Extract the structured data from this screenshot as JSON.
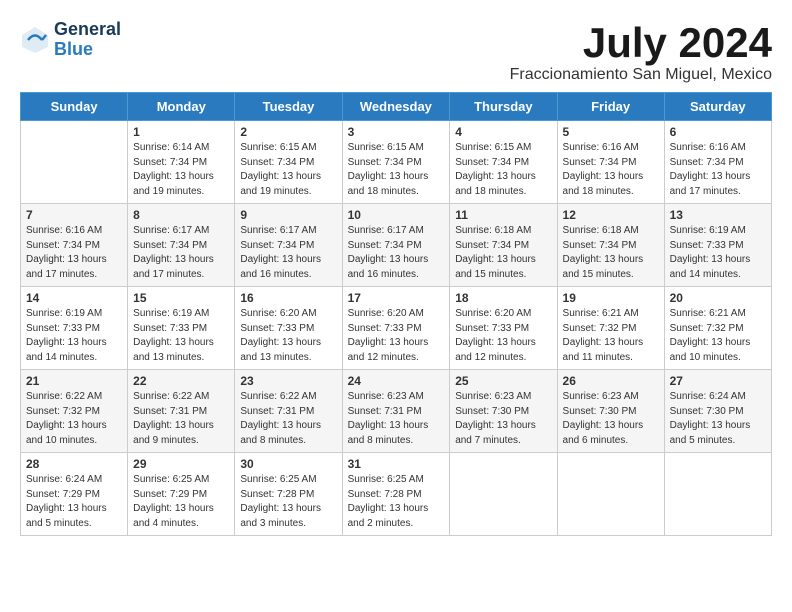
{
  "header": {
    "logo_general": "General",
    "logo_blue": "Blue",
    "month_title": "July 2024",
    "location": "Fraccionamiento San Miguel, Mexico"
  },
  "weekdays": [
    "Sunday",
    "Monday",
    "Tuesday",
    "Wednesday",
    "Thursday",
    "Friday",
    "Saturday"
  ],
  "weeks": [
    [
      {
        "day": "",
        "sunrise": "",
        "sunset": "",
        "daylight": ""
      },
      {
        "day": "1",
        "sunrise": "Sunrise: 6:14 AM",
        "sunset": "Sunset: 7:34 PM",
        "daylight": "Daylight: 13 hours and 19 minutes."
      },
      {
        "day": "2",
        "sunrise": "Sunrise: 6:15 AM",
        "sunset": "Sunset: 7:34 PM",
        "daylight": "Daylight: 13 hours and 19 minutes."
      },
      {
        "day": "3",
        "sunrise": "Sunrise: 6:15 AM",
        "sunset": "Sunset: 7:34 PM",
        "daylight": "Daylight: 13 hours and 18 minutes."
      },
      {
        "day": "4",
        "sunrise": "Sunrise: 6:15 AM",
        "sunset": "Sunset: 7:34 PM",
        "daylight": "Daylight: 13 hours and 18 minutes."
      },
      {
        "day": "5",
        "sunrise": "Sunrise: 6:16 AM",
        "sunset": "Sunset: 7:34 PM",
        "daylight": "Daylight: 13 hours and 18 minutes."
      },
      {
        "day": "6",
        "sunrise": "Sunrise: 6:16 AM",
        "sunset": "Sunset: 7:34 PM",
        "daylight": "Daylight: 13 hours and 17 minutes."
      }
    ],
    [
      {
        "day": "7",
        "sunrise": "Sunrise: 6:16 AM",
        "sunset": "Sunset: 7:34 PM",
        "daylight": "Daylight: 13 hours and 17 minutes."
      },
      {
        "day": "8",
        "sunrise": "Sunrise: 6:17 AM",
        "sunset": "Sunset: 7:34 PM",
        "daylight": "Daylight: 13 hours and 17 minutes."
      },
      {
        "day": "9",
        "sunrise": "Sunrise: 6:17 AM",
        "sunset": "Sunset: 7:34 PM",
        "daylight": "Daylight: 13 hours and 16 minutes."
      },
      {
        "day": "10",
        "sunrise": "Sunrise: 6:17 AM",
        "sunset": "Sunset: 7:34 PM",
        "daylight": "Daylight: 13 hours and 16 minutes."
      },
      {
        "day": "11",
        "sunrise": "Sunrise: 6:18 AM",
        "sunset": "Sunset: 7:34 PM",
        "daylight": "Daylight: 13 hours and 15 minutes."
      },
      {
        "day": "12",
        "sunrise": "Sunrise: 6:18 AM",
        "sunset": "Sunset: 7:34 PM",
        "daylight": "Daylight: 13 hours and 15 minutes."
      },
      {
        "day": "13",
        "sunrise": "Sunrise: 6:19 AM",
        "sunset": "Sunset: 7:33 PM",
        "daylight": "Daylight: 13 hours and 14 minutes."
      }
    ],
    [
      {
        "day": "14",
        "sunrise": "Sunrise: 6:19 AM",
        "sunset": "Sunset: 7:33 PM",
        "daylight": "Daylight: 13 hours and 14 minutes."
      },
      {
        "day": "15",
        "sunrise": "Sunrise: 6:19 AM",
        "sunset": "Sunset: 7:33 PM",
        "daylight": "Daylight: 13 hours and 13 minutes."
      },
      {
        "day": "16",
        "sunrise": "Sunrise: 6:20 AM",
        "sunset": "Sunset: 7:33 PM",
        "daylight": "Daylight: 13 hours and 13 minutes."
      },
      {
        "day": "17",
        "sunrise": "Sunrise: 6:20 AM",
        "sunset": "Sunset: 7:33 PM",
        "daylight": "Daylight: 13 hours and 12 minutes."
      },
      {
        "day": "18",
        "sunrise": "Sunrise: 6:20 AM",
        "sunset": "Sunset: 7:33 PM",
        "daylight": "Daylight: 13 hours and 12 minutes."
      },
      {
        "day": "19",
        "sunrise": "Sunrise: 6:21 AM",
        "sunset": "Sunset: 7:32 PM",
        "daylight": "Daylight: 13 hours and 11 minutes."
      },
      {
        "day": "20",
        "sunrise": "Sunrise: 6:21 AM",
        "sunset": "Sunset: 7:32 PM",
        "daylight": "Daylight: 13 hours and 10 minutes."
      }
    ],
    [
      {
        "day": "21",
        "sunrise": "Sunrise: 6:22 AM",
        "sunset": "Sunset: 7:32 PM",
        "daylight": "Daylight: 13 hours and 10 minutes."
      },
      {
        "day": "22",
        "sunrise": "Sunrise: 6:22 AM",
        "sunset": "Sunset: 7:31 PM",
        "daylight": "Daylight: 13 hours and 9 minutes."
      },
      {
        "day": "23",
        "sunrise": "Sunrise: 6:22 AM",
        "sunset": "Sunset: 7:31 PM",
        "daylight": "Daylight: 13 hours and 8 minutes."
      },
      {
        "day": "24",
        "sunrise": "Sunrise: 6:23 AM",
        "sunset": "Sunset: 7:31 PM",
        "daylight": "Daylight: 13 hours and 8 minutes."
      },
      {
        "day": "25",
        "sunrise": "Sunrise: 6:23 AM",
        "sunset": "Sunset: 7:30 PM",
        "daylight": "Daylight: 13 hours and 7 minutes."
      },
      {
        "day": "26",
        "sunrise": "Sunrise: 6:23 AM",
        "sunset": "Sunset: 7:30 PM",
        "daylight": "Daylight: 13 hours and 6 minutes."
      },
      {
        "day": "27",
        "sunrise": "Sunrise: 6:24 AM",
        "sunset": "Sunset: 7:30 PM",
        "daylight": "Daylight: 13 hours and 5 minutes."
      }
    ],
    [
      {
        "day": "28",
        "sunrise": "Sunrise: 6:24 AM",
        "sunset": "Sunset: 7:29 PM",
        "daylight": "Daylight: 13 hours and 5 minutes."
      },
      {
        "day": "29",
        "sunrise": "Sunrise: 6:25 AM",
        "sunset": "Sunset: 7:29 PM",
        "daylight": "Daylight: 13 hours and 4 minutes."
      },
      {
        "day": "30",
        "sunrise": "Sunrise: 6:25 AM",
        "sunset": "Sunset: 7:28 PM",
        "daylight": "Daylight: 13 hours and 3 minutes."
      },
      {
        "day": "31",
        "sunrise": "Sunrise: 6:25 AM",
        "sunset": "Sunset: 7:28 PM",
        "daylight": "Daylight: 13 hours and 2 minutes."
      },
      {
        "day": "",
        "sunrise": "",
        "sunset": "",
        "daylight": ""
      },
      {
        "day": "",
        "sunrise": "",
        "sunset": "",
        "daylight": ""
      },
      {
        "day": "",
        "sunrise": "",
        "sunset": "",
        "daylight": ""
      }
    ]
  ]
}
